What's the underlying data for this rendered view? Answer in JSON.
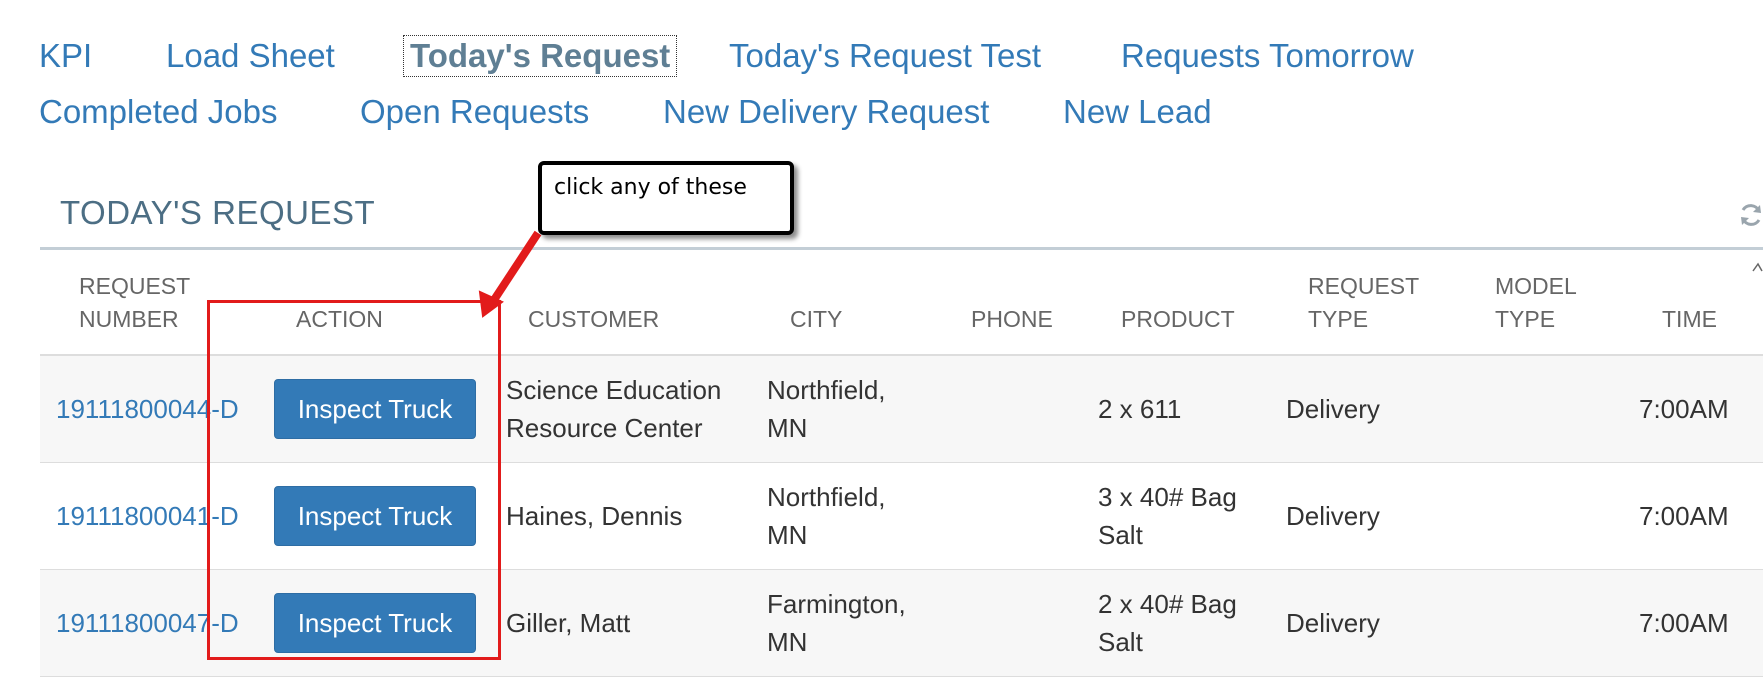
{
  "nav": {
    "items": [
      {
        "label": "KPI"
      },
      {
        "label": "Load Sheet"
      },
      {
        "label": "Today's Request"
      },
      {
        "label": "Today's Request Test"
      },
      {
        "label": "Requests Tomorrow"
      },
      {
        "label": "Completed Jobs"
      },
      {
        "label": "Open Requests"
      },
      {
        "label": "New Delivery Request"
      },
      {
        "label": "New Lead"
      }
    ],
    "active": "Today's Request"
  },
  "section": {
    "title": "TODAY'S REQUEST",
    "refresh_icon": "refresh-icon"
  },
  "table": {
    "headers": {
      "request_number": [
        "REQUEST",
        "NUMBER"
      ],
      "action": "ACTION",
      "customer": "CUSTOMER",
      "city": "CITY",
      "phone": "PHONE",
      "product": "PRODUCT",
      "request_type": [
        "REQUEST",
        "TYPE"
      ],
      "model_type": [
        "MODEL",
        "TYPE"
      ],
      "time": "TIME"
    },
    "rows": [
      {
        "request_number": "19111800044-D",
        "action": "Inspect Truck",
        "customer": [
          "Science Education",
          "Resource Center"
        ],
        "city": [
          "Northfield,",
          "MN"
        ],
        "phone": "",
        "product": [
          "2 x 611"
        ],
        "request_type": "Delivery",
        "model_type": "",
        "time": "7:00AM"
      },
      {
        "request_number": "19111800041-D",
        "action": "Inspect Truck",
        "customer": [
          "Haines, Dennis"
        ],
        "city": [
          "Northfield,",
          "MN"
        ],
        "phone": "",
        "product": [
          "3 x 40# Bag",
          "Salt"
        ],
        "request_type": "Delivery",
        "model_type": "",
        "time": "7:00AM"
      },
      {
        "request_number": "19111800047-D",
        "action": "Inspect Truck",
        "customer": [
          "Giller, Matt"
        ],
        "city": [
          "Farmington,",
          "MN"
        ],
        "phone": "",
        "product": [
          "2 x 40# Bag",
          "Salt"
        ],
        "request_type": "Delivery",
        "model_type": "",
        "time": "7:00AM"
      }
    ]
  },
  "annotation": {
    "callout_text": "click any of these",
    "color": "#e21b1b"
  },
  "colors": {
    "link": "#337ab7",
    "button": "#337ab7",
    "section_title": "#4c6e84"
  }
}
